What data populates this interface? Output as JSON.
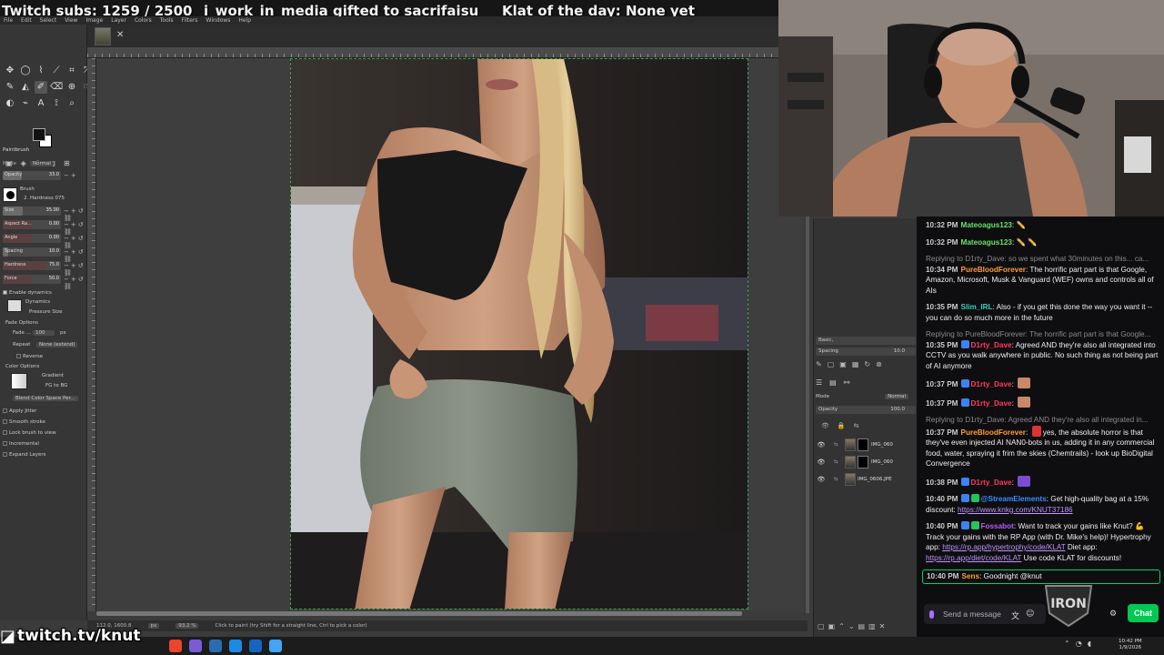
{
  "overlay": {
    "subs": "Twitch subs: 1259 / 2500",
    "gift": "i_work_in_media gifted to sacrifaisu",
    "klat": "Klat of the day: None yet"
  },
  "gimp": {
    "menus": [
      "File",
      "Edit",
      "Select",
      "View",
      "Image",
      "Layer",
      "Colors",
      "Tools",
      "Filters",
      "Windows",
      "Help"
    ],
    "tool_options": {
      "title": "Paintbrush",
      "mode_label": "Mode",
      "mode_value": "Normal",
      "opacity_label": "Opacity",
      "opacity_value": "33.0",
      "brush_label": "Brush",
      "brush_name": "2. Hardness 075",
      "size_label": "Size",
      "size_value": "35.00",
      "aspect_label": "Aspect Ra...",
      "aspect_value": "0.00",
      "angle_label": "Angle",
      "angle_value": "0.00",
      "spacing_label": "Spacing",
      "spacing_value": "10.0",
      "hardness_label": "Hardness",
      "hardness_value": "75.0",
      "force_label": "Force",
      "force_value": "50.0",
      "enable_dynamics": "Enable dynamics",
      "dynamics_label": "Dynamics",
      "dynamics_value": "Pressure Size",
      "fade_options": "Fade Options",
      "fade_label": "Fade ...",
      "fade_value": "100",
      "fade_unit": "px",
      "repeat_label": "Repeat",
      "repeat_value": "None (extend)",
      "reverse": "Reverse",
      "color_options": "Color Options",
      "gradient_label": "Gradient",
      "gradient_value": "FG to BG",
      "blend_space": "Blend Color Space Per...",
      "apply_jitter": "Apply Jitter",
      "smooth_stroke": "Smooth stroke",
      "lock_brush": "Lock brush to view",
      "incremental": "Incremental",
      "expand_layers": "Expand Layers"
    },
    "status": {
      "coords": "112.0, 1600.8",
      "unit": "px",
      "zoom": "93.2 %",
      "hint": "Click to paint (try Shift for a straight line, Ctrl to pick a color)"
    },
    "right_panel": {
      "brush_preset": "Basic,",
      "spacing_label": "Spacing",
      "spacing_value": "10.0",
      "mode_label": "Mode",
      "mode_value": "Normal",
      "opacity_label": "Opacity",
      "opacity_value": "100.0",
      "layers": [
        "IMG_060",
        "IMG_060",
        "IMG_0606.JPE"
      ]
    }
  },
  "twitch_tag": "twitch.tv/knut",
  "chat": {
    "messages": [
      {
        "time": "10:32 PM",
        "user": "Mateoagus123",
        "color": "#6be26b",
        "text": "✏️",
        "reply": ""
      },
      {
        "time": "10:32 PM",
        "user": "Mateoagus123",
        "color": "#6be26b",
        "text": "✏️ ✏️",
        "reply": ""
      },
      {
        "time": "10:34 PM",
        "user": "PureBloodForever",
        "color": "#ff9b3d",
        "text": "The horrific part part is that Google, Amazon, Microsoft, Musk & Vanguard (WEF) owns and controls all of AIs",
        "reply": "Replying to D1rty_Dave: so we spent what 30minutes on this... ca..."
      },
      {
        "time": "10:35 PM",
        "user": "Slim_IRL",
        "color": "#35d0b8",
        "text": "Also - if you get this done the way you want it -- you can do so much more in the future",
        "reply": ""
      },
      {
        "time": "10:35 PM",
        "user": "D1rty_Dave",
        "color": "#ff3b5c",
        "text": "Agreed AND they're also all integrated into CCTV as you walk anywhere in public. No such thing as not being part of AI anymore",
        "reply": "Replying to PureBloodForever: The horrific part part is that Google..."
      },
      {
        "time": "10:37 PM",
        "user": "D1rty_Dave",
        "color": "#ff3b5c",
        "text": "",
        "reply": ""
      },
      {
        "time": "10:37 PM",
        "user": "D1rty_Dave",
        "color": "#ff3b5c",
        "text": "",
        "reply": ""
      },
      {
        "time": "10:37 PM",
        "user": "PureBloodForever",
        "color": "#ff9b3d",
        "text": "yes, the absolute horror is that they've even injected AI NAN0-bots in us, adding it in any commercial food, water, spraying it frim the skies (Chemtrails) - look up BioDigital Convergence",
        "reply": "Replying to D1rty_Dave: Agreed AND they're also all integrated in..."
      },
      {
        "time": "10:38 PM",
        "user": "D1rty_Dave",
        "color": "#ff3b5c",
        "text": "",
        "reply": ""
      },
      {
        "time": "10:40 PM",
        "user": "@StreamElements",
        "color": "#3b8cff",
        "text": "Get high-quality bag at a 15% discount: ",
        "link": "https://www.knkg.com/KNUT37186",
        "reply": ""
      },
      {
        "time": "10:40 PM",
        "user": "Fossabot",
        "color": "#b65cff",
        "text": "Want to track your gains like Knut? 💪 Track your gains with the RP App (with Dr. Mike's help)! Hypertrophy app: ",
        "link": "https://rp.app/hypertrophy/code/KLAT",
        "text2": " Diet app: ",
        "link2": "https://rp.app/diet/code/KLAT",
        "text3": " Use code KLAT for discounts!",
        "reply": ""
      },
      {
        "time": "10:40 PM",
        "user": "Sens",
        "color": "#ff9b3d",
        "text": "Goodnight @knut",
        "reply": ""
      }
    ],
    "input_placeholder": "Send a message",
    "chat_button": "Chat",
    "logo_text": "IRON"
  },
  "taskbar": {
    "time": "10:42 PM",
    "date": "1/9/2026"
  }
}
